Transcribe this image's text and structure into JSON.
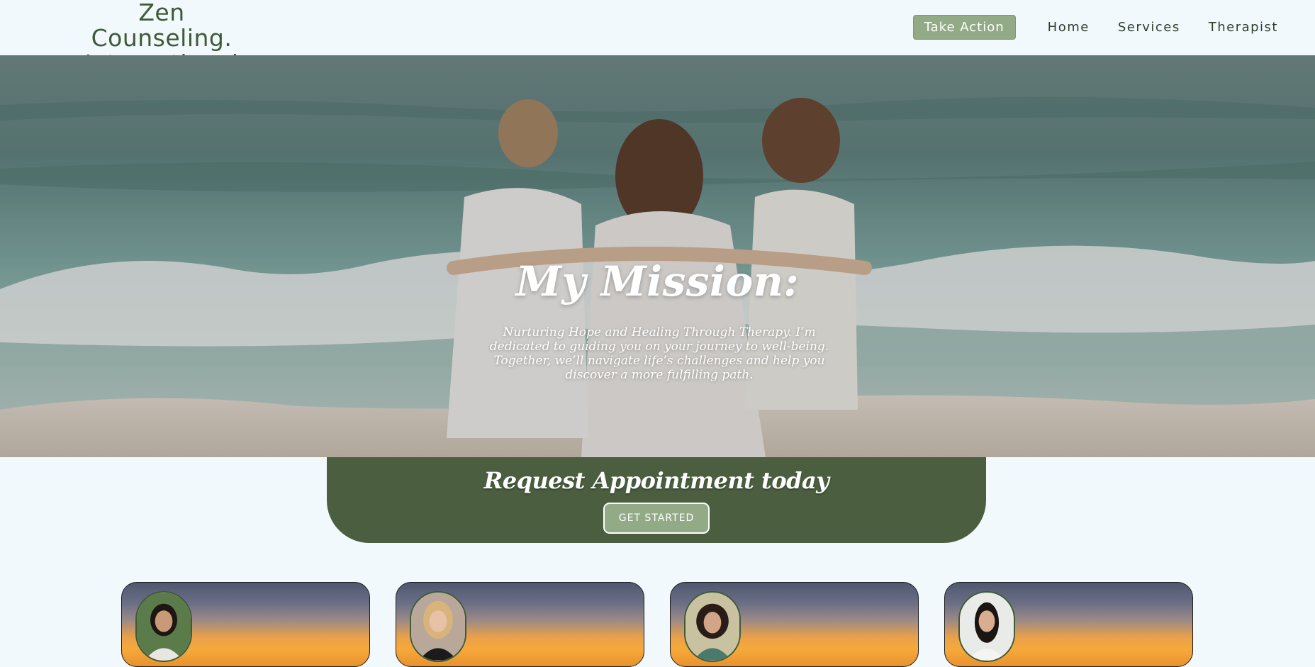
{
  "header": {
    "logo_line1": "Zen Counseling.",
    "logo_line2": "International",
    "nav": {
      "take_action": "Take Action",
      "home": "Home",
      "services": "Services",
      "therapist": "Therapist"
    }
  },
  "hero": {
    "title": "My Mission:",
    "text": "Nurturing Hope and Healing Through Therapy. I’m dedicated to guiding you on your journey to well-being. Together, we’ll navigate life’s challenges and help you discover a more fulfilling path."
  },
  "appointment": {
    "title": "Request Appointment today",
    "button": "GET STARTED"
  },
  "therapists": [
    {
      "image": "therapist-photo-1"
    },
    {
      "image": "therapist-photo-2"
    },
    {
      "image": "therapist-photo-3"
    },
    {
      "image": "therapist-photo-4"
    }
  ],
  "colors": {
    "page_bg": "#f1f9fd",
    "brand_green": "#3e5a36",
    "banner_green": "#4b5f40",
    "button_sage": "#93aa86"
  }
}
